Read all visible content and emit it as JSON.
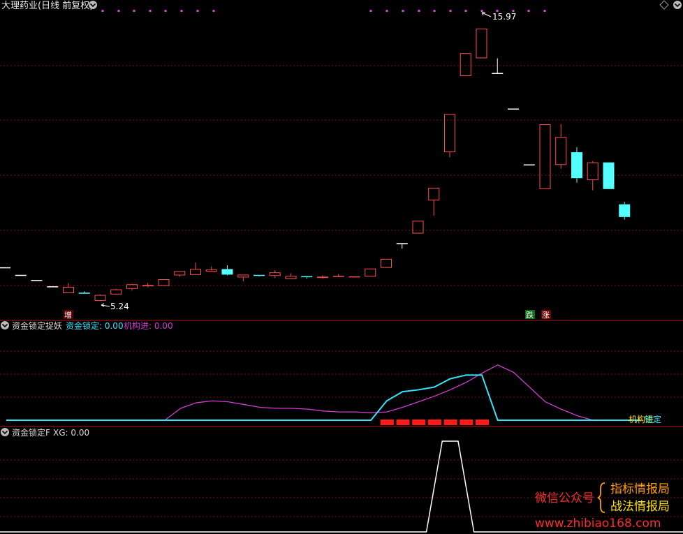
{
  "header": {
    "title": "大理药业(日线 前复权)",
    "panel2_label": "资金锁定捉妖",
    "panel2_stat1": "资金锁定: 0.00",
    "panel2_stat2": "机构进: 0.00",
    "panel3_label": "资金锁定F",
    "panel3_stat": "XG: 0.00"
  },
  "icons": {
    "title_dropdown": "chevron-down-icon",
    "top_right": "diamond-icon",
    "panel_toggle": "chevron-down-icon"
  },
  "colors": {
    "background": "#000000",
    "up_candle": "#ff4d4d",
    "down_candle": "#54ffff",
    "doji": "#ffffff",
    "grid": "#7a1010",
    "separator": "#b01818",
    "line_lock": "#33e6ff",
    "line_inst": "#d23cd2",
    "signal_bar": "#ff1a1a",
    "xg_line": "#ffffff",
    "label_red": "#ff3333",
    "label_orange": "#ff9a00",
    "label_yellow": "#ffe000",
    "marker_magenta": "#e040e0"
  },
  "markers": {
    "high_price": "15.97",
    "low_price": "5.24",
    "tag_zeng": "增",
    "tag_die": "跌",
    "tag_zhang": "涨",
    "end_label_a": "机构进",
    "end_label_b": "锁定"
  },
  "watermark": {
    "wechat_label": "微信公众号",
    "brand1": "指标情报局",
    "brand2": "战法情报局",
    "url": "www.zhibiao168.com"
  },
  "chart_data": [
    {
      "type": "candlestick",
      "title": "大理药业(日线 前复权)",
      "candles": [
        {
          "o": 6.55,
          "c": 6.55,
          "h": 6.55,
          "l": 6.55,
          "kind": "doji"
        },
        {
          "o": 6.25,
          "c": 6.25,
          "h": 6.25,
          "l": 6.25,
          "kind": "doji"
        },
        {
          "o": 6.05,
          "c": 6.05,
          "h": 6.05,
          "l": 6.05,
          "kind": "doji"
        },
        {
          "o": 5.8,
          "c": 5.8,
          "h": 5.8,
          "l": 5.8,
          "kind": "doji"
        },
        {
          "o": 5.55,
          "c": 5.8,
          "h": 5.95,
          "l": 5.55,
          "kind": "up"
        },
        {
          "o": 5.55,
          "c": 5.53,
          "h": 5.62,
          "l": 5.53,
          "kind": "down"
        },
        {
          "o": 5.25,
          "c": 5.48,
          "h": 5.5,
          "l": 5.24,
          "kind": "up"
        },
        {
          "o": 5.5,
          "c": 5.7,
          "h": 5.72,
          "l": 5.48,
          "kind": "up"
        },
        {
          "o": 5.72,
          "c": 5.9,
          "h": 5.92,
          "l": 5.65,
          "kind": "up"
        },
        {
          "o": 5.82,
          "c": 5.87,
          "h": 5.95,
          "l": 5.78,
          "kind": "up"
        },
        {
          "o": 5.83,
          "c": 6.1,
          "h": 6.1,
          "l": 5.83,
          "kind": "up"
        },
        {
          "o": 6.25,
          "c": 6.42,
          "h": 6.42,
          "l": 6.2,
          "kind": "up"
        },
        {
          "o": 6.27,
          "c": 6.5,
          "h": 6.75,
          "l": 6.27,
          "kind": "up"
        },
        {
          "o": 6.4,
          "c": 6.48,
          "h": 6.6,
          "l": 6.4,
          "kind": "up"
        },
        {
          "o": 6.5,
          "c": 6.28,
          "h": 6.65,
          "l": 6.25,
          "kind": "down"
        },
        {
          "o": 6.17,
          "c": 6.28,
          "h": 6.28,
          "l": 6.02,
          "kind": "up"
        },
        {
          "o": 6.25,
          "c": 6.22,
          "h": 6.26,
          "l": 6.2,
          "kind": "down"
        },
        {
          "o": 6.23,
          "c": 6.37,
          "h": 6.45,
          "l": 6.15,
          "kind": "up"
        },
        {
          "o": 6.1,
          "c": 6.23,
          "h": 6.33,
          "l": 6.1,
          "kind": "up"
        },
        {
          "o": 6.2,
          "c": 6.17,
          "h": 6.2,
          "l": 6.12,
          "kind": "down"
        },
        {
          "o": 6.15,
          "c": 6.2,
          "h": 6.25,
          "l": 6.12,
          "kind": "up"
        },
        {
          "o": 6.18,
          "c": 6.21,
          "h": 6.3,
          "l": 6.18,
          "kind": "up"
        },
        {
          "o": 6.17,
          "c": 6.19,
          "h": 6.19,
          "l": 6.17,
          "kind": "up"
        },
        {
          "o": 6.2,
          "c": 6.52,
          "h": 6.52,
          "l": 6.2,
          "kind": "up"
        },
        {
          "o": 6.55,
          "c": 6.9,
          "h": 6.9,
          "l": 6.55,
          "kind": "up"
        },
        {
          "o": 7.5,
          "c": 7.5,
          "h": 7.5,
          "l": 7.3,
          "kind": "doji"
        },
        {
          "o": 7.9,
          "c": 8.4,
          "h": 8.4,
          "l": 7.9,
          "kind": "up"
        },
        {
          "o": 9.2,
          "c": 9.7,
          "h": 9.7,
          "l": 8.6,
          "kind": "up"
        },
        {
          "o": 11.1,
          "c": 12.6,
          "h": 12.6,
          "l": 10.9,
          "kind": "up"
        },
        {
          "o": 14.1,
          "c": 15.0,
          "h": 15.0,
          "l": 14.1,
          "kind": "up"
        },
        {
          "o": 14.8,
          "c": 15.97,
          "h": 15.97,
          "l": 14.8,
          "kind": "up"
        },
        {
          "o": 14.2,
          "c": 14.2,
          "h": 14.8,
          "l": 14.2,
          "kind": "doji"
        },
        {
          "o": 12.8,
          "c": 12.8,
          "h": 12.8,
          "l": 12.8,
          "kind": "doji"
        },
        {
          "o": 10.6,
          "c": 10.6,
          "h": 10.6,
          "l": 10.6,
          "kind": "doji"
        },
        {
          "o": 9.65,
          "c": 12.2,
          "h": 12.2,
          "l": 9.65,
          "kind": "up"
        },
        {
          "o": 10.6,
          "c": 11.7,
          "h": 12.2,
          "l": 10.45,
          "kind": "up"
        },
        {
          "o": 11.1,
          "c": 10.08,
          "h": 11.3,
          "l": 9.9,
          "kind": "down"
        },
        {
          "o": 10.0,
          "c": 10.7,
          "h": 10.75,
          "l": 9.6,
          "kind": "up"
        },
        {
          "o": 10.7,
          "c": 9.65,
          "h": 10.7,
          "l": 9.65,
          "kind": "down"
        },
        {
          "o": 9.05,
          "c": 8.55,
          "h": 9.15,
          "l": 8.45,
          "kind": "down"
        }
      ],
      "high_label": "15.97",
      "low_label": "5.24"
    },
    {
      "type": "line",
      "title": "资金锁定捉妖",
      "ylim": [
        0,
        100
      ],
      "series": [
        {
          "name": "资金锁定",
          "x": [
            0,
            10,
            23,
            24,
            25,
            26,
            27,
            28,
            29,
            30,
            31,
            40
          ],
          "values": [
            0,
            0,
            0,
            21,
            31,
            33,
            36,
            45,
            49,
            49,
            0,
            0
          ]
        },
        {
          "name": "机构进",
          "x": [
            0,
            10,
            11,
            12,
            13,
            14,
            15,
            16,
            17,
            18,
            19,
            20,
            21,
            22,
            23,
            24,
            25,
            26,
            27,
            28,
            29,
            30,
            31,
            32,
            33,
            34,
            35,
            36,
            37,
            38,
            40
          ],
          "values": [
            0,
            0,
            13,
            19,
            21,
            20,
            17,
            14,
            13,
            13,
            12,
            10,
            9,
            9,
            8,
            9,
            14,
            20,
            26,
            33,
            41,
            51,
            60,
            52,
            36,
            20,
            12,
            5,
            0,
            0,
            0
          ]
        }
      ],
      "signal_bars_x": [
        24,
        25,
        26,
        27,
        28,
        29,
        30
      ]
    },
    {
      "type": "line",
      "title": "资金锁定F",
      "ylim": [
        0,
        1
      ],
      "series": [
        {
          "name": "XG",
          "x": [
            0,
            26.5,
            27.5,
            28.5,
            29.5,
            40
          ],
          "values": [
            0,
            0,
            1,
            1,
            0,
            0
          ]
        }
      ]
    }
  ]
}
